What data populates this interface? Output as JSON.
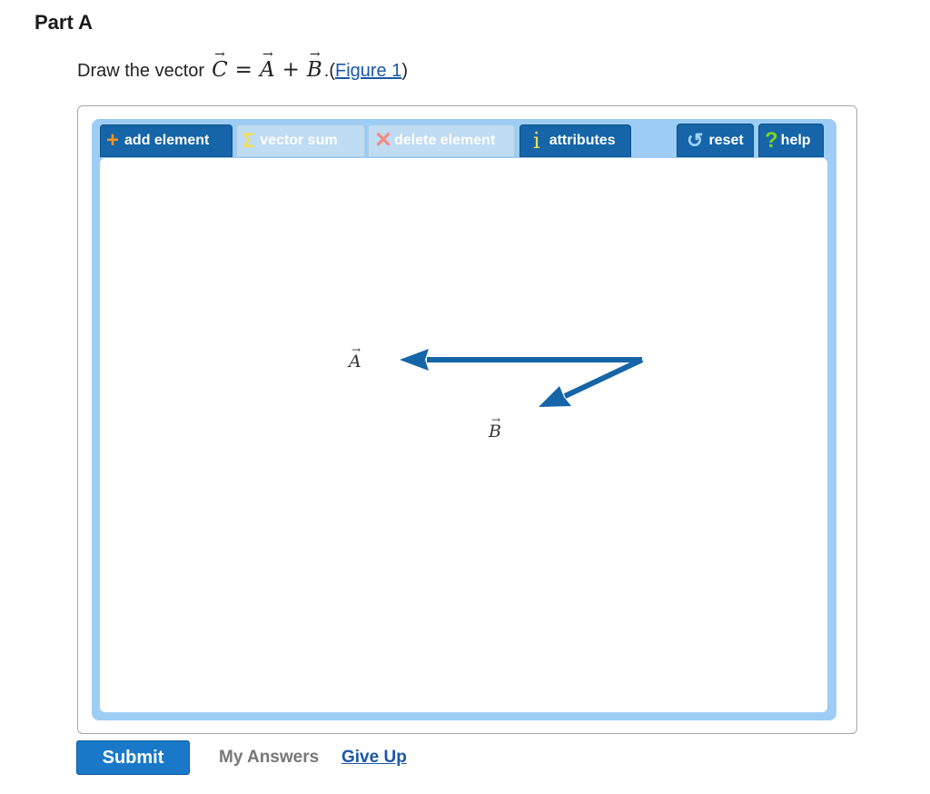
{
  "part": {
    "title": "Part A"
  },
  "prompt": {
    "lead": "Draw the vector",
    "var_c": "C",
    "equals": "=",
    "var_a": "A",
    "plus": "+",
    "var_b": "B",
    "tail": ".(",
    "link": "Figure 1",
    "close": ")",
    "arrow": "→"
  },
  "toolbar": {
    "add_label": "add element",
    "sum_label": "vector sum",
    "delete_label": "delete element",
    "attributes_label": "attributes",
    "reset_label": "reset",
    "help_label": "help"
  },
  "canvas": {
    "vector_color": "#1565a8",
    "labels": {
      "a": "A",
      "b": "B",
      "arrow": "→"
    }
  },
  "footer": {
    "submit_label": "Submit",
    "my_answers_label": "My Answers",
    "give_up_label": "Give Up"
  },
  "colors": {
    "accent": "#1979c8",
    "toolbar_frame": "#9dcdf5",
    "link": "#1b57a8",
    "add_icon": "#f7931e",
    "delete_icon": "#f28b82",
    "help_icon": "#7ed321"
  }
}
